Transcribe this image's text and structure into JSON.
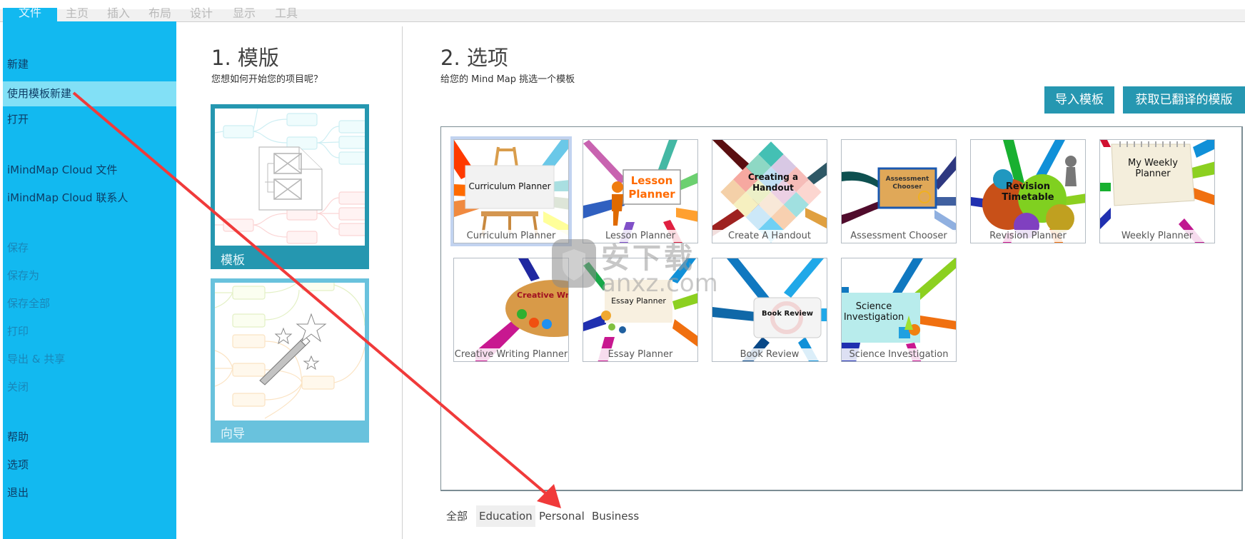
{
  "ribbon": {
    "tabs": [
      {
        "label": "文件",
        "active": true
      },
      {
        "label": "主页"
      },
      {
        "label": "插入"
      },
      {
        "label": "布局"
      },
      {
        "label": "设计"
      },
      {
        "label": "显示"
      },
      {
        "label": "工具"
      }
    ]
  },
  "sidebar": {
    "items": [
      {
        "label": "新建",
        "state": "enabled"
      },
      {
        "label": "使用模板新建",
        "state": "selected"
      },
      {
        "label": "打开",
        "state": "enabled"
      },
      {
        "label": "iMindMap Cloud 文件",
        "state": "enabled"
      },
      {
        "label": "iMindMap Cloud 联系人",
        "state": "enabled"
      },
      {
        "label": "保存",
        "state": "disabled"
      },
      {
        "label": "保存为",
        "state": "disabled"
      },
      {
        "label": "保存全部",
        "state": "disabled"
      },
      {
        "label": "打印",
        "state": "disabled"
      },
      {
        "label": "导出 & 共享",
        "state": "disabled"
      },
      {
        "label": "关闭",
        "state": "disabled"
      },
      {
        "label": "帮助",
        "state": "enabled"
      },
      {
        "label": "选项",
        "state": "enabled"
      },
      {
        "label": "退出",
        "state": "enabled"
      }
    ]
  },
  "section1": {
    "number": "1.",
    "title": "模版",
    "subtitle": "您想如何开始您的项目呢？",
    "cards": [
      {
        "label": "模板",
        "icon": "template-document-icon",
        "selected": true
      },
      {
        "label": "向导",
        "icon": "magic-wand-icon",
        "selected": false
      }
    ]
  },
  "section2": {
    "number": "2.",
    "title": "选项",
    "subtitle": "给您的 Mind Map 挑选一个模板",
    "buttons": {
      "import": "导入模板",
      "get_translated": "获取已翻译的模版"
    },
    "templates": [
      {
        "name": "Curriculum Planner",
        "thumb_text": "Curriculum Planner",
        "selected": true
      },
      {
        "name": "Lesson Planner",
        "thumb_text": "Lesson Planner"
      },
      {
        "name": "Create A Handout",
        "thumb_text": "Creating a Handout"
      },
      {
        "name": "Assessment Chooser",
        "thumb_text": "Assessment Chooser"
      },
      {
        "name": "Revision Planner",
        "thumb_text": "Revision Timetable"
      },
      {
        "name": "Weekly Planner",
        "thumb_text": "My Weekly Planner"
      },
      {
        "name": "Creative Writing Planner",
        "thumb_text": "Creative Wr"
      },
      {
        "name": "Essay Planner",
        "thumb_text": "Essay Planner"
      },
      {
        "name": "Book Review",
        "thumb_text": "Book Review"
      },
      {
        "name": "Science Investigation",
        "thumb_text": "Science Investigation"
      }
    ],
    "filters": [
      {
        "label": "全部"
      },
      {
        "label": "Education",
        "active": true
      },
      {
        "label": "Personal"
      },
      {
        "label": "Business"
      }
    ]
  },
  "watermark": {
    "text": "安下载",
    "subtext": "anxz.com"
  },
  "colors": {
    "sidebar_bg": "#12b9f0",
    "sidebar_selected": "#82e0f6",
    "accent_button": "#2697b1",
    "template_card": "#2597b0",
    "wizard_card": "#69c2dd",
    "annotation_arrow": "#f03a3a"
  }
}
